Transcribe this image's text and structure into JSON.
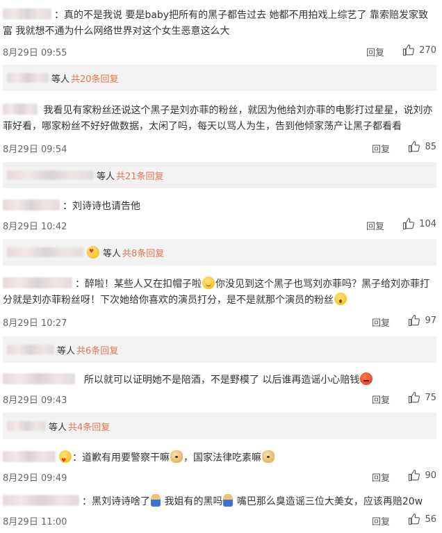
{
  "comments": [
    {
      "text": "：真的不是我说 要是baby把所有的黑子都告过去 她都不用拍戏上综艺了 靠索赔发家致富 我就想不通为什么网络世界对这个女生恶意这么大",
      "time": "8月29日 09:55",
      "reply_label": "回复",
      "likes": "270",
      "sub": {
        "users": "等人",
        "count": "共20条回复"
      }
    },
    {
      "text": "我看见有家粉丝还说这个黑子是刘亦菲的粉丝，就因为他给刘亦菲的电影打过星星，说刘亦菲好看，哪家粉丝不好好做数据，太闲了吗，每天以骂人为生，告到他倾家荡产让黑子都看看",
      "time": "8月29日 09:54",
      "reply_label": "回复",
      "likes": "85",
      "sub": {
        "users": "等人",
        "count": "共21条回复"
      }
    },
    {
      "text": "：刘诗诗也请告他",
      "time": "8月29日 10:42",
      "reply_label": "回复",
      "likes": "104",
      "sub": {
        "users": "等人",
        "count": "共8条回复"
      }
    },
    {
      "text_a": "：醉啦！某些人又在扣帽子啦",
      "text_b": "你没见到这个黑子也骂刘亦菲吗？黑子给刘亦菲打分就是刘亦菲粉丝呀！下次她给你喜欢的演员打分，是不是就那个演员的粉丝",
      "time": "8月29日 10:27",
      "reply_label": "回复",
      "likes": "97",
      "sub": {
        "users": "等人",
        "count": "共6条回复"
      }
    },
    {
      "text": "所以就可以证明她不是陪酒，不是野模了 以后谁再造谣小心赔钱",
      "time": "8月29日 09:43",
      "reply_label": "回复",
      "likes": "75",
      "sub": {
        "users": "等人",
        "count": "共4条回复"
      }
    },
    {
      "text_a": "：道歉有用要警察干嘛",
      "text_b": "，国家法律吃素嘛",
      "time": "8月29日 09:49",
      "reply_label": "回复",
      "likes": "90"
    },
    {
      "text_a": "：黑刘诗诗啥了",
      "text_b": "我姐有的黑吗",
      "text_c": "嘴巴那么臭造谣三位大美女，应该再赔20w",
      "time": "8月29日 11:00",
      "reply_label": "回复",
      "likes": "56"
    }
  ],
  "icons": {
    "like": "thumbs-up-icon",
    "emoji": [
      "smile-emoji-icon",
      "shock-emoji-icon",
      "angry-emoji-icon",
      "doge-emoji-icon",
      "heart-eyes-emoji-icon",
      "person-emoji-icon"
    ]
  },
  "colors": {
    "accent": "#eb7350",
    "text": "#333333",
    "meta": "#666666",
    "subbox_bg": "#f2f2f2"
  }
}
